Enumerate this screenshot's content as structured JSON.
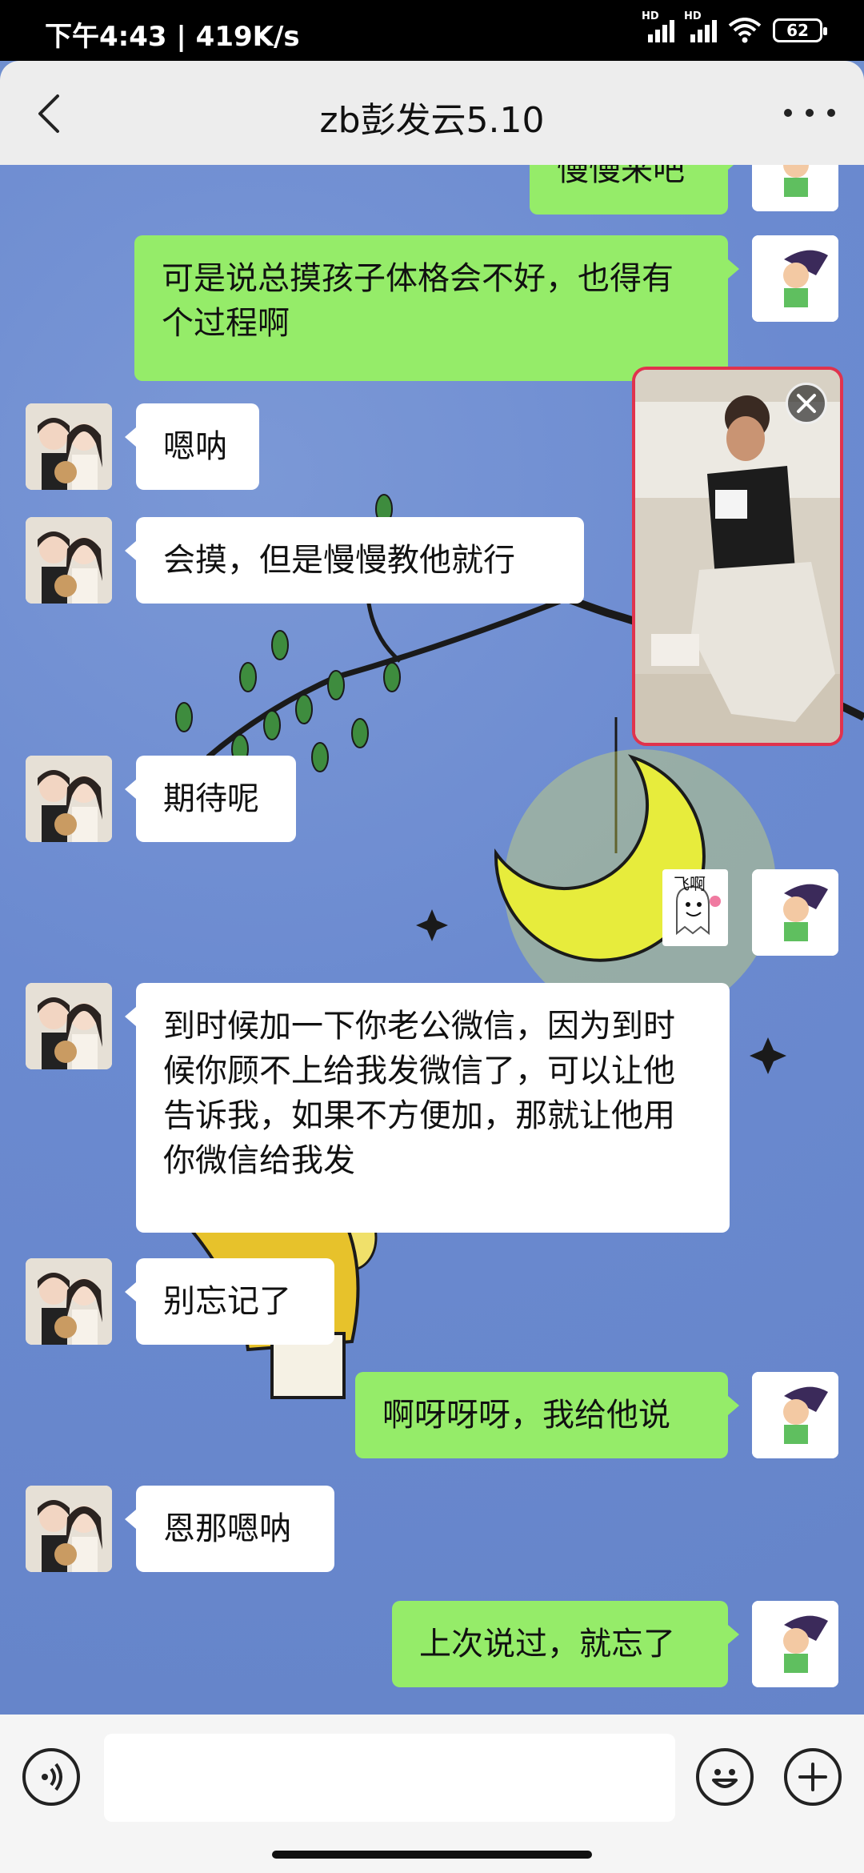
{
  "status_bar": {
    "time": "下午4:43 | 419K/s",
    "signal1_badge": "HD",
    "signal2_badge": "HD",
    "battery": "62"
  },
  "header": {
    "title": "zb彭发云5.10"
  },
  "messages": [
    {
      "id": "m0",
      "side": "out",
      "text": "慢慢来吧"
    },
    {
      "id": "m1",
      "side": "out",
      "text": "可是说总摸孩子体格会不好，也得有个过程啊"
    },
    {
      "id": "m2",
      "side": "in",
      "text": "嗯呐"
    },
    {
      "id": "m3",
      "side": "in",
      "text": "会摸，但是慢慢教他就行"
    },
    {
      "id": "m4",
      "side": "in",
      "text": "期待呢"
    },
    {
      "id": "m5",
      "side": "out",
      "type": "sticker",
      "text": "飞啊"
    },
    {
      "id": "m6",
      "side": "in",
      "text": "到时候加一下你老公微信，因为到时候你顾不上给我发微信了，可以让他告诉我，如果不方便加，那就让他用你微信给我发"
    },
    {
      "id": "m7",
      "side": "in",
      "text": "别忘记了"
    },
    {
      "id": "m8",
      "side": "out",
      "text": "啊呀呀呀，我给他说"
    },
    {
      "id": "m9",
      "side": "in",
      "text": "恩那嗯呐"
    },
    {
      "id": "m10",
      "side": "out",
      "text": "上次说过，就忘了"
    }
  ],
  "video_overlay": {
    "icon": "close-icon"
  },
  "input_bar": {
    "value": "",
    "voice_icon": "voice-icon",
    "emoji_icon": "emoji-icon",
    "plus_icon": "plus-icon"
  }
}
